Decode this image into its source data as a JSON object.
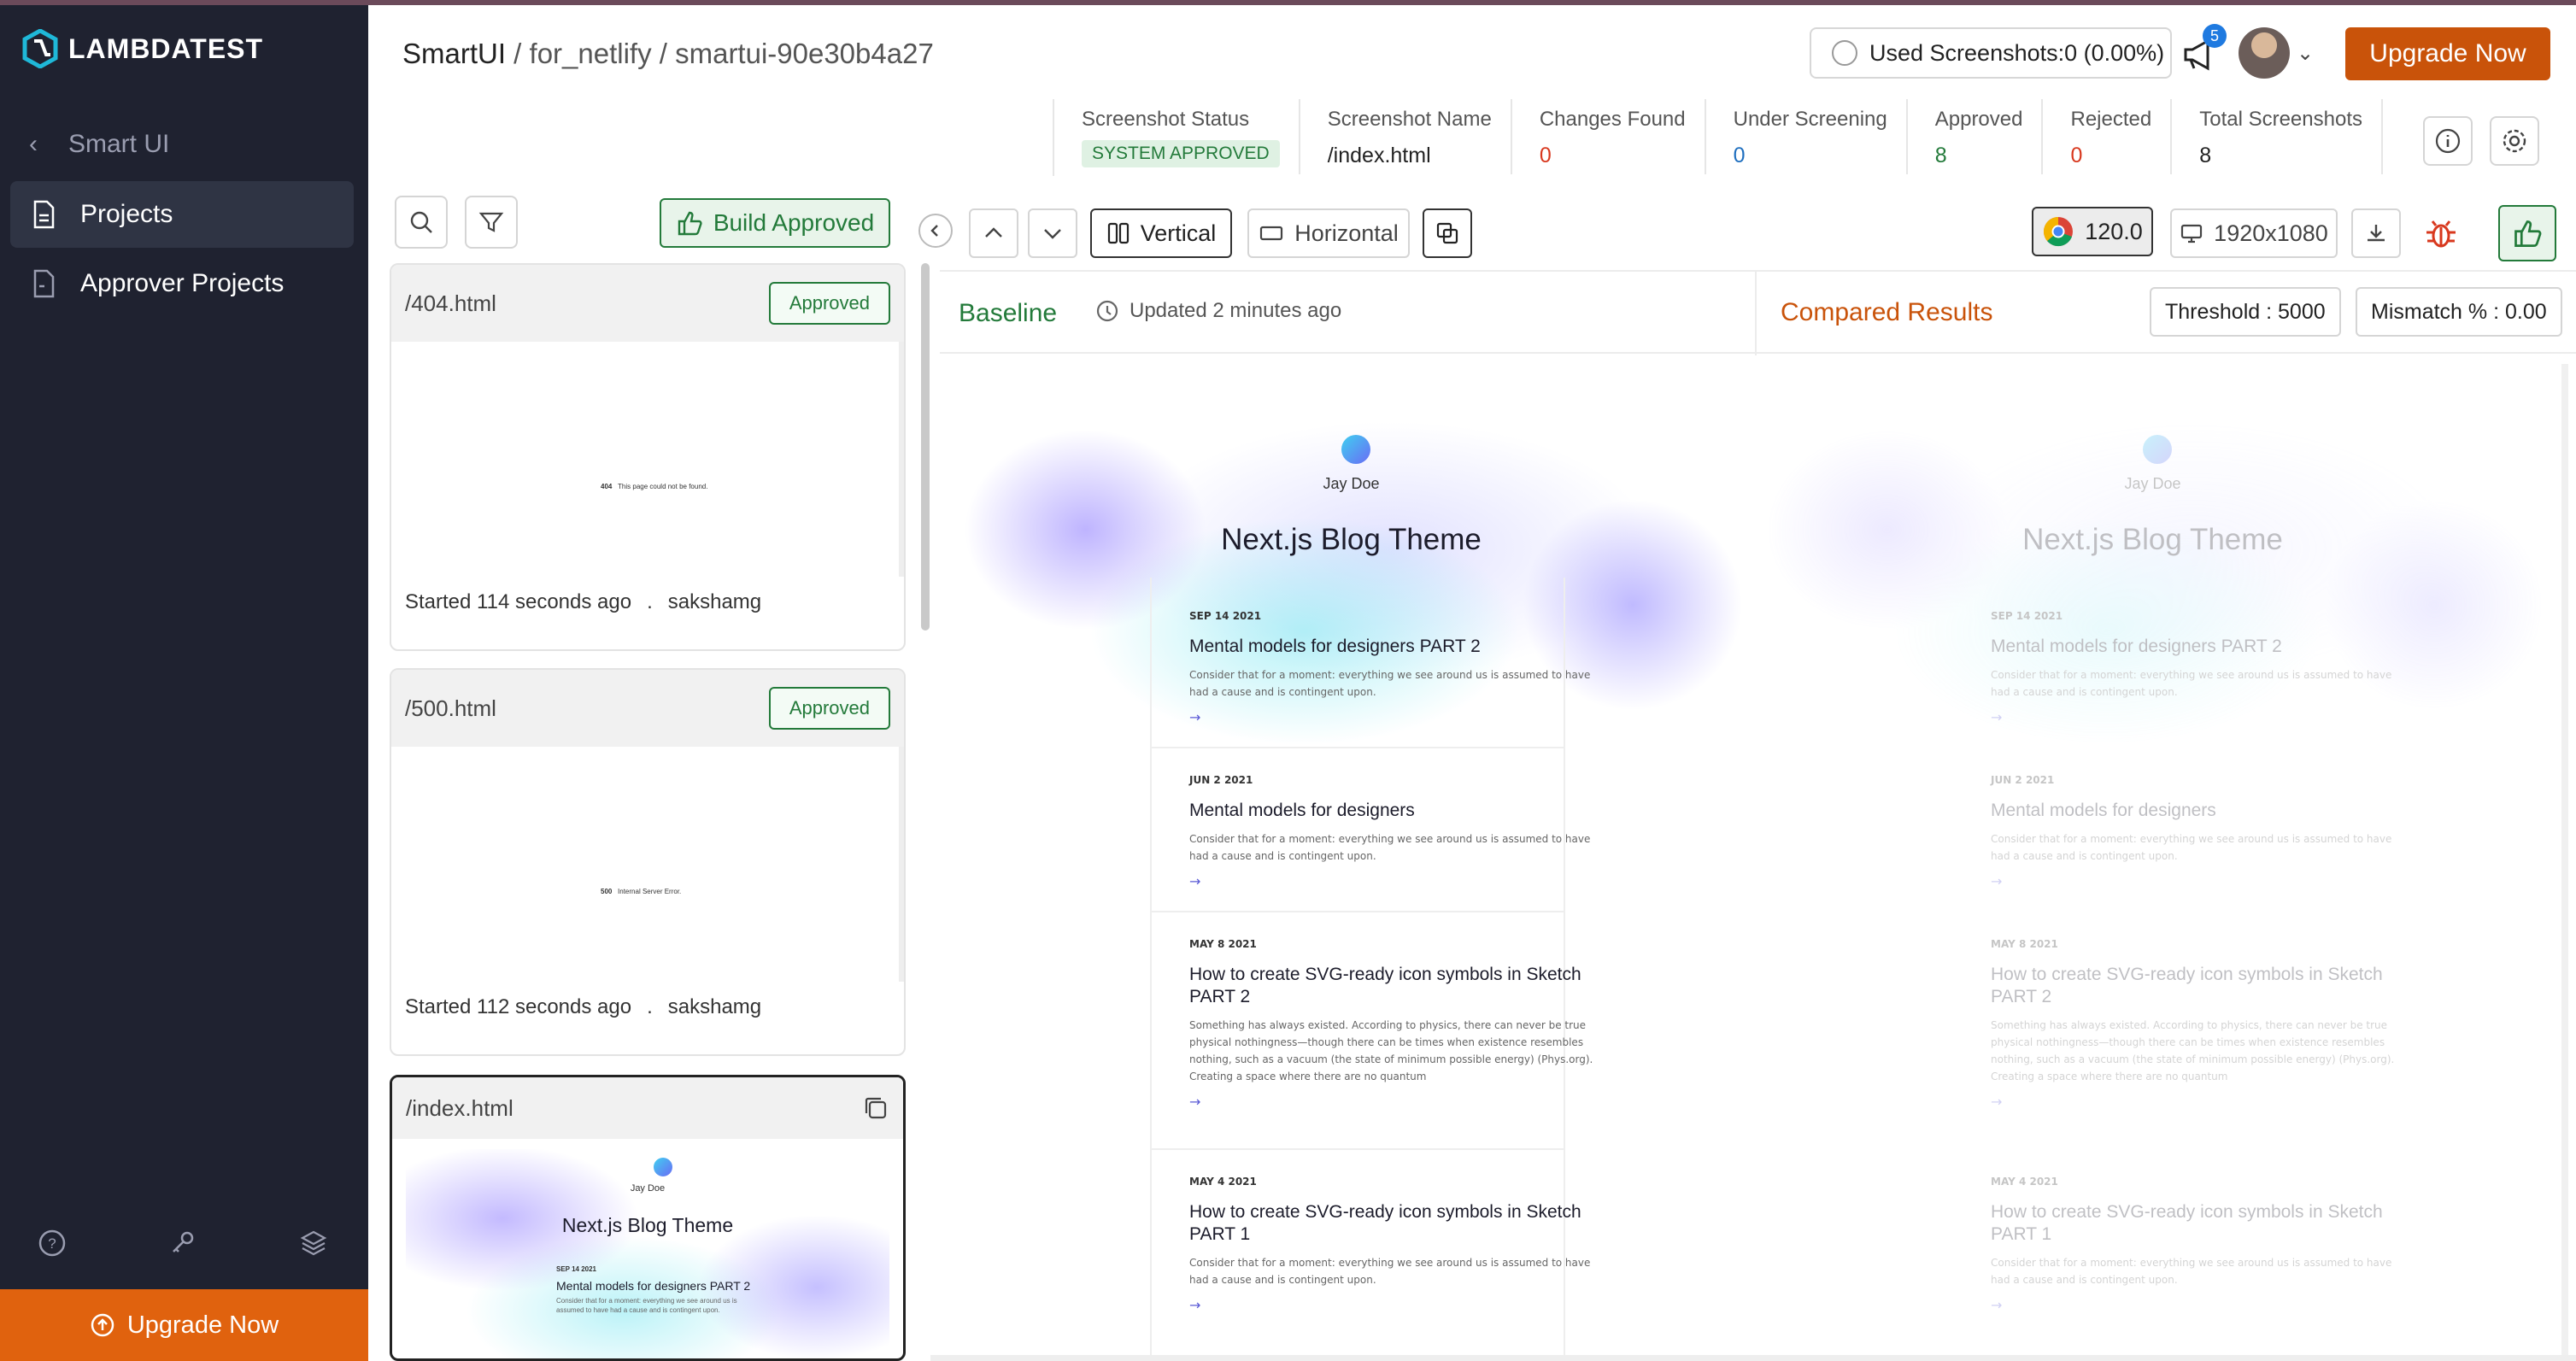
{
  "brand": {
    "name": "LAMBDATEST"
  },
  "sidebar": {
    "back_label": "Smart UI",
    "items": [
      {
        "label": "Projects",
        "icon": "document-icon",
        "active": true
      },
      {
        "label": "Approver Projects",
        "icon": "file-icon",
        "active": false
      }
    ],
    "bottom_icons": [
      "help-icon",
      "key-icon",
      "layers-icon"
    ],
    "upgrade_label": "Upgrade Now"
  },
  "header": {
    "breadcrumb_root": "SmartUI",
    "breadcrumb_rest": " / for_netlify / smartui-90e30b4a27",
    "used_screenshots": "Used Screenshots:0 (0.00%)",
    "notification_count": "5",
    "upgrade_label": "Upgrade Now"
  },
  "stats": [
    {
      "label": "Screenshot Status",
      "value": "SYSTEM APPROVED",
      "kind": "pill"
    },
    {
      "label": "Screenshot Name",
      "value": "/index.html",
      "kind": "plain"
    },
    {
      "label": "Changes Found",
      "value": "0",
      "kind": "red"
    },
    {
      "label": "Under Screening",
      "value": "0",
      "kind": "blue"
    },
    {
      "label": "Approved",
      "value": "8",
      "kind": "green"
    },
    {
      "label": "Rejected",
      "value": "0",
      "kind": "red"
    },
    {
      "label": "Total Screenshots",
      "value": "8",
      "kind": "plain"
    }
  ],
  "list": {
    "build_approved_label": "Build Approved",
    "cards": [
      {
        "name": "/404.html",
        "status": "Approved",
        "mini": "404",
        "mini_text": "This page could not be found.",
        "started": "Started 114 seconds ago",
        "sep": ".",
        "user": "sakshamg"
      },
      {
        "name": "/500.html",
        "status": "Approved",
        "mini": "500",
        "mini_text": "Internal Server Error.",
        "started": "Started 112 seconds ago",
        "sep": ".",
        "user": "sakshamg"
      },
      {
        "name": "/index.html",
        "status": "",
        "mini_name": "Jay Doe",
        "mini_title": "Next.js Blog Theme",
        "mini_date": "SEP 14 2021",
        "mini_post": "Mental models for designers PART 2",
        "mini_desc": "Consider that for a moment: everything we see around us is assumed to have had a cause and is contingent upon."
      }
    ]
  },
  "toolbar": {
    "vertical_label": "Vertical",
    "horizontal_label": "Horizontal",
    "browser_version": "120.0",
    "resolution": "1920x1080"
  },
  "panels": {
    "baseline_label": "Baseline",
    "updated_label": "Updated 2 minutes ago",
    "compared_label": "Compared Results",
    "threshold_label": "Threshold : 5000",
    "mismatch_label": "Mismatch % : 0.00"
  },
  "blog": {
    "author": "Jay Doe",
    "title": "Next.js Blog Theme",
    "arrow": "→",
    "posts": [
      {
        "date": "SEP 14 2021",
        "title": "Mental models for designers PART 2",
        "desc": "Consider that for a moment: everything we see around us is assumed to have had a cause and is contingent upon."
      },
      {
        "date": "JUN 2 2021",
        "title": "Mental models for designers",
        "desc": "Consider that for a moment: everything we see around us is assumed to have had a cause and is contingent upon."
      },
      {
        "date": "MAY 8 2021",
        "title": "How to create SVG-ready icon symbols in Sketch PART 2",
        "desc": "Something has always existed. According to physics, there can never be true physical nothingness—though there can be times when existence resembles nothing, such as a vacuum (the state of minimum possible energy) (Phys.org). Creating a space where there are no quantum"
      },
      {
        "date": "MAY 4 2021",
        "title": "How to create SVG-ready icon symbols in Sketch PART 1",
        "desc": "Consider that for a moment: everything we see around us is assumed to have had a cause and is contingent upon."
      }
    ]
  },
  "colors": {
    "accent": "#c9530a",
    "sidebar_bg": "#1f2230",
    "approved": "#237a3a",
    "danger": "#d8381e"
  }
}
